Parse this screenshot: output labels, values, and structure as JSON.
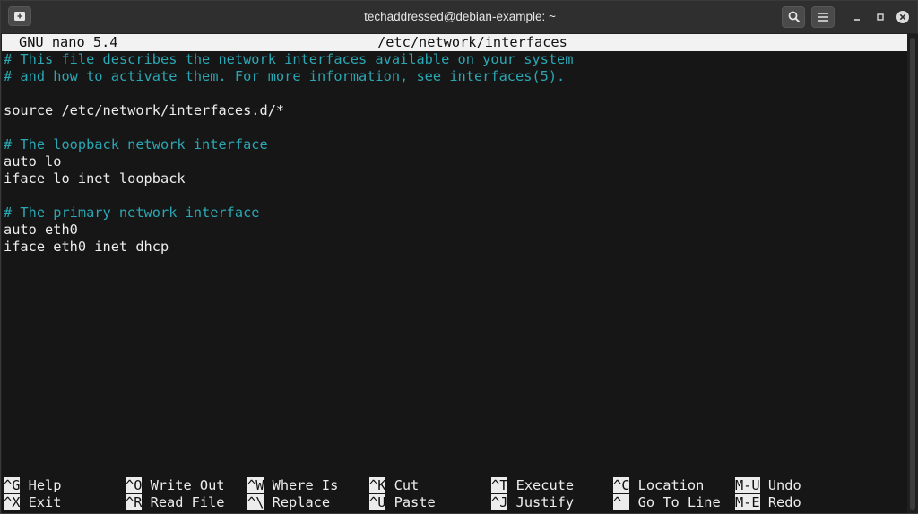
{
  "window": {
    "title": "techaddressed@debian-example: ~"
  },
  "nano": {
    "app": "GNU nano 5.4",
    "file": "/etc/network/interfaces"
  },
  "lines": [
    {
      "text": "# This file describes the network interfaces available on your system",
      "comment": true
    },
    {
      "text": "# and how to activate them. For more information, see interfaces(5).",
      "comment": true
    },
    {
      "text": "",
      "comment": false
    },
    {
      "text": "source /etc/network/interfaces.d/*",
      "comment": false
    },
    {
      "text": "",
      "comment": false
    },
    {
      "text": "# The loopback network interface",
      "comment": true
    },
    {
      "text": "auto lo",
      "comment": false
    },
    {
      "text": "iface lo inet loopback",
      "comment": false
    },
    {
      "text": "",
      "comment": false
    },
    {
      "text": "# The primary network interface",
      "comment": true
    },
    {
      "text": "auto eth0",
      "comment": false
    },
    {
      "text": "iface eth0 inet dhcp",
      "comment": false
    }
  ],
  "shortcuts": [
    {
      "key": "^G",
      "label": "Help"
    },
    {
      "key": "^X",
      "label": "Exit"
    },
    {
      "key": "^O",
      "label": "Write Out"
    },
    {
      "key": "^R",
      "label": "Read File"
    },
    {
      "key": "^W",
      "label": "Where Is"
    },
    {
      "key": "^\\",
      "label": "Replace"
    },
    {
      "key": "^K",
      "label": "Cut"
    },
    {
      "key": "^U",
      "label": "Paste"
    },
    {
      "key": "^T",
      "label": "Execute"
    },
    {
      "key": "^J",
      "label": "Justify"
    },
    {
      "key": "^C",
      "label": "Location"
    },
    {
      "key": "^_",
      "label": "Go To Line"
    },
    {
      "key": "M-U",
      "label": "Undo"
    },
    {
      "key": "M-E",
      "label": "Redo"
    }
  ],
  "colors": {
    "comment": "#2aa7b3",
    "text": "#ededed",
    "header_bg": "#f2f2f2",
    "terminal_bg": "#161616"
  }
}
